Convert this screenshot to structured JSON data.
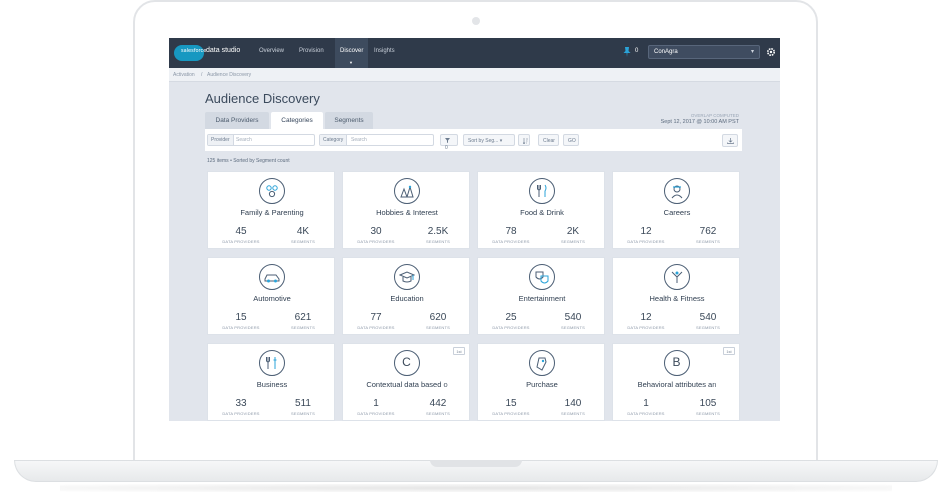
{
  "nav": {
    "app_name": "data studio",
    "logo_text": "salesforce",
    "items": [
      "Overview",
      "Provision",
      "Discover",
      "Insights"
    ],
    "pin_count": "0",
    "org": "ConAgra"
  },
  "breadcrumb": [
    "Activation",
    "/",
    "Audience Discovery"
  ],
  "page": {
    "title": "Audience Discovery",
    "tabs": [
      "Data Providers",
      "Categories",
      "Segments"
    ],
    "overlap_label": "OVERLAP COMPUTED",
    "overlap_date": "Sept 12, 2017 @ 10:00 AM PST"
  },
  "filters": {
    "provider_label": "Provider",
    "provider_placeholder": "Search",
    "category_label": "Category",
    "category_placeholder": "Search",
    "filter_count": "0",
    "sort_label": "Sort by Seg...",
    "clear": "Clear",
    "go": "GO"
  },
  "result_count": "125 items • Sorted by Segment count",
  "stat_labels": {
    "providers": "DATA PROVIDERS",
    "segments": "SEGMENTS"
  },
  "cards": [
    {
      "title": "Family & Parenting",
      "providers": "45",
      "segments": "4K",
      "icon": "family-icon"
    },
    {
      "title": "Hobbies & Interest",
      "providers": "30",
      "segments": "2.5K",
      "icon": "hobbies-icon"
    },
    {
      "title": "Food & Drink",
      "providers": "78",
      "segments": "2K",
      "icon": "food-icon"
    },
    {
      "title": "Careers",
      "providers": "12",
      "segments": "762",
      "icon": "careers-icon"
    },
    {
      "title": "Automotive",
      "providers": "15",
      "segments": "621",
      "icon": "car-icon"
    },
    {
      "title": "Education",
      "providers": "77",
      "segments": "620",
      "icon": "graduation-cap-icon"
    },
    {
      "title": "Entertainment",
      "providers": "25",
      "segments": "540",
      "icon": "masks-icon"
    },
    {
      "title": "Health & Fitness",
      "providers": "12",
      "segments": "540",
      "icon": "fitness-icon"
    },
    {
      "title": "Business",
      "providers": "33",
      "segments": "511",
      "icon": "business-icon"
    },
    {
      "title": "Contextual data based o",
      "providers": "1",
      "segments": "442",
      "icon": "letter-c-icon",
      "letter": "C",
      "badge": "1st"
    },
    {
      "title": "Purchase",
      "providers": "15",
      "segments": "140",
      "icon": "tag-icon"
    },
    {
      "title": "Behavioral attributes an",
      "providers": "1",
      "segments": "105",
      "icon": "letter-b-icon",
      "letter": "B",
      "badge": "1st"
    }
  ]
}
